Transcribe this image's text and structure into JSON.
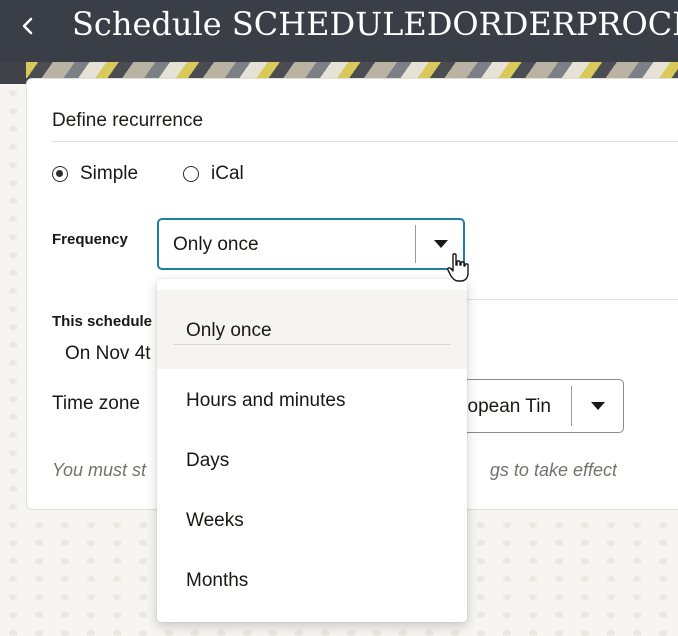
{
  "header": {
    "title": "Schedule SCHEDULEDORDERPROCESSING",
    "back_icon": "chevron-left-icon"
  },
  "recurrence": {
    "section_title": "Define recurrence",
    "options": [
      {
        "label": "Simple",
        "checked": true
      },
      {
        "label": "iCal",
        "checked": false
      }
    ]
  },
  "frequency": {
    "label": "Frequency",
    "value": "Only once",
    "options": [
      "Only once",
      "Hours and minutes",
      "Days",
      "Weeks",
      "Months"
    ],
    "selected_index": 0
  },
  "schedule": {
    "label": "This schedule",
    "value": "On Nov 4t"
  },
  "timezone": {
    "label": "Time zone",
    "value": "opean Tin"
  },
  "hint": {
    "left": "You must st",
    "right": "gs to take effect"
  },
  "colors": {
    "header_bg": "#3a3f47",
    "focus_border": "#227e9e"
  }
}
